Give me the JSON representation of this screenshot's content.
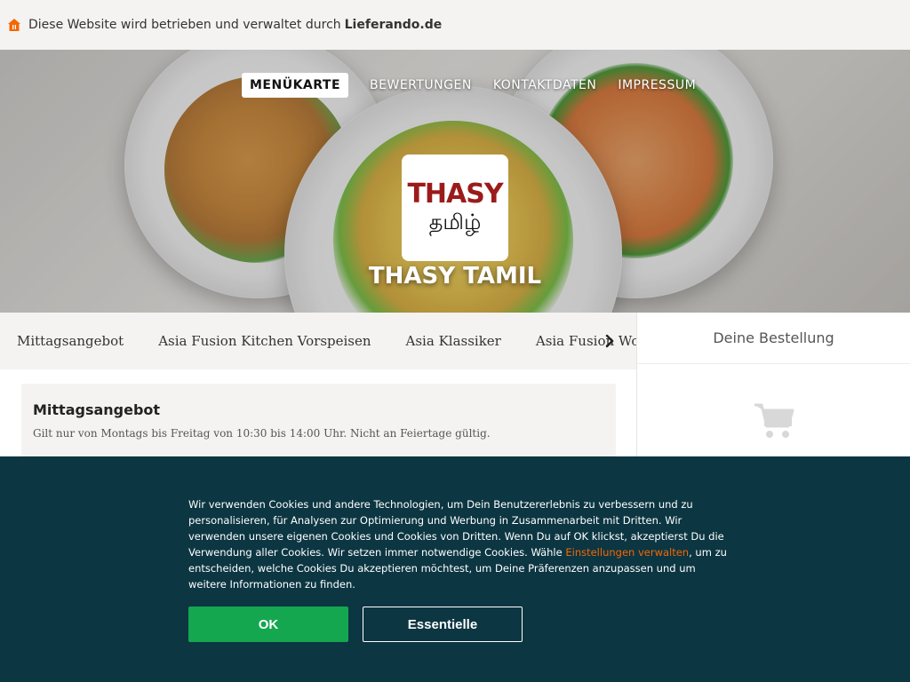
{
  "topbar": {
    "notice": "Diese Website wird betrieben und verwaltet durch",
    "brand": "Lieferando.de"
  },
  "nav": {
    "items": [
      {
        "label": "MENÜKARTE",
        "active": true
      },
      {
        "label": "BEWERTUNGEN",
        "active": false
      },
      {
        "label": "KONTAKTDATEN",
        "active": false
      },
      {
        "label": "IMPRESSUM",
        "active": false
      }
    ]
  },
  "restaurant": {
    "logo_line1": "THASY",
    "logo_line2": "தமிழ்",
    "name": "THASY TAMIL"
  },
  "categories": [
    "Mittagsangebot",
    "Asia Fusion Kitchen Vorspeisen",
    "Asia Klassiker",
    "Asia Fusion Wok"
  ],
  "section": {
    "title": "Mittagsangebot",
    "description": "Gilt nur von Montags bis Freitag von 10:30 bis 14:00 Uhr. Nicht an Feiertage gültig."
  },
  "basket": {
    "title": "Deine Bestellung"
  },
  "cookie": {
    "text_before_link": "Wir verwenden Cookies und andere Technologien, um Dein Benutzererlebnis zu verbessern und zu personalisieren, für Analysen zur Optimierung und Werbung in Zusammenarbeit mit Dritten. Wir verwenden unsere eigenen Cookies und Cookies von Dritten. Wenn Du auf OK klickst, akzeptierst Du die Verwendung aller Cookies. Wir setzen immer notwendige Cookies. Wähle ",
    "link": "Einstellungen verwalten",
    "text_after_link": ", um zu entscheiden, welche Cookies Du akzeptieren möchtest, um Deine Präferenzen anzupassen und um weitere Informationen zu finden.",
    "ok_label": "OK",
    "essential_label": "Essentielle"
  },
  "colors": {
    "brand_orange": "#f36805",
    "ok_green": "#14a750",
    "banner_bg": "#0c3642",
    "logo_red": "#9b1b1b"
  }
}
